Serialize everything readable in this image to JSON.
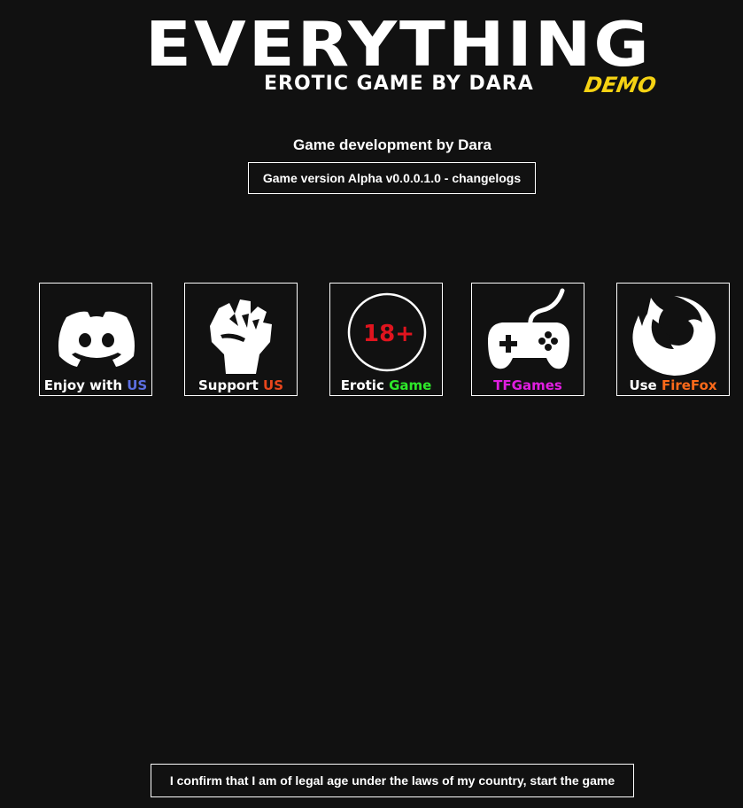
{
  "logo": {
    "title": "EVERYTHING",
    "subtitle": "EROTIC GAME BY DARA",
    "badge": "DEMO"
  },
  "developer_credit": "Game development by Dara",
  "version_button": "Game version Alpha v0.0.0.1.0 - changelogs",
  "tiles": [
    {
      "name": "discord",
      "icon": "discord-icon",
      "label_white": "Enjoy with ",
      "label_accent": "US",
      "accent_color": "#5b6ee1"
    },
    {
      "name": "support",
      "icon": "raised-fist-icon",
      "label_white": "Support ",
      "label_accent": "US",
      "accent_color": "#e8461c"
    },
    {
      "name": "erotic-game",
      "icon": "18-plus-icon",
      "icon_text": "18+",
      "label_white": "Erotic ",
      "label_accent": "Game",
      "accent_color": "#2ee82a"
    },
    {
      "name": "tfgames",
      "icon": "gamepad-icon",
      "label_white": "",
      "label_accent": "TFGames",
      "accent_color": "#e01ee0"
    },
    {
      "name": "firefox",
      "icon": "firefox-icon",
      "label_white": "Use ",
      "label_accent": "FireFox",
      "accent_color": "#ff6a1a"
    }
  ],
  "confirm_button": "I confirm that I am of legal age under the laws of my country, start the game",
  "colors": {
    "background": "#111111",
    "demo_yellow": "#f5d213",
    "age_red": "#e0141e"
  }
}
